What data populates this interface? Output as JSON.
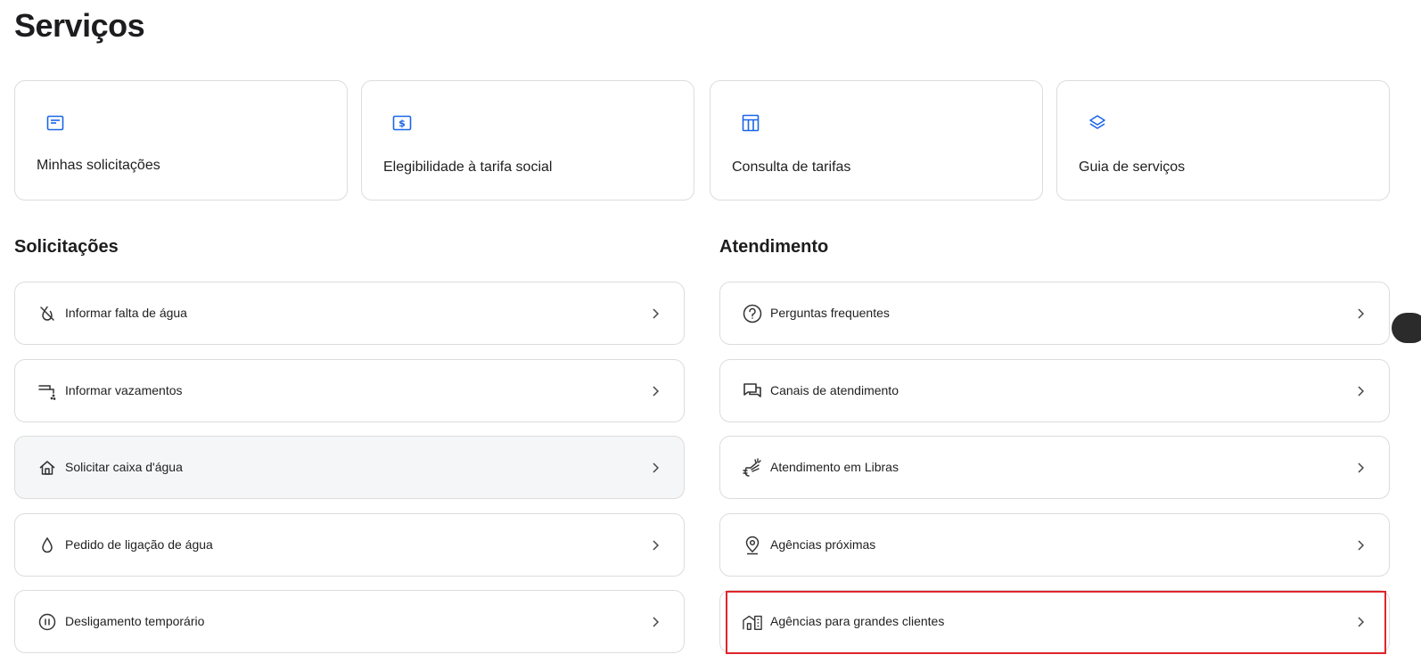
{
  "page": {
    "title": "Serviços"
  },
  "colors": {
    "accent": "#1a66e8",
    "highlight": "#e0252b",
    "icon": "#333333"
  },
  "quick_cards": [
    {
      "label": "Minhas solicitações",
      "icon": "window-icon"
    },
    {
      "label": "Elegibilidade à tarifa social",
      "icon": "dollar-bill-icon"
    },
    {
      "label": "Consulta de tarifas",
      "icon": "table-icon"
    },
    {
      "label": "Guia de serviços",
      "icon": "layers-icon"
    }
  ],
  "solicitacoes": {
    "title": "Solicitações",
    "items": [
      {
        "label": "Informar falta de água",
        "icon": "no-water-drop-icon"
      },
      {
        "label": "Informar vazamentos",
        "icon": "leaking-tap-icon"
      },
      {
        "label": "Solicitar caixa d'água",
        "icon": "house-icon"
      },
      {
        "label": "Pedido de ligação de água",
        "icon": "water-drop-icon"
      },
      {
        "label": "Desligamento temporário",
        "icon": "pause-circle-icon"
      }
    ]
  },
  "atendimento": {
    "title": "Atendimento",
    "items": [
      {
        "label": "Perguntas frequentes",
        "icon": "question-circle-icon"
      },
      {
        "label": "Canais de atendimento",
        "icon": "chat-bubbles-icon"
      },
      {
        "label": "Atendimento em Libras",
        "icon": "sign-language-icon"
      },
      {
        "label": "Agências próximas",
        "icon": "map-pin-icon"
      },
      {
        "label": "Agências para grandes clientes",
        "icon": "building-icon"
      }
    ]
  }
}
